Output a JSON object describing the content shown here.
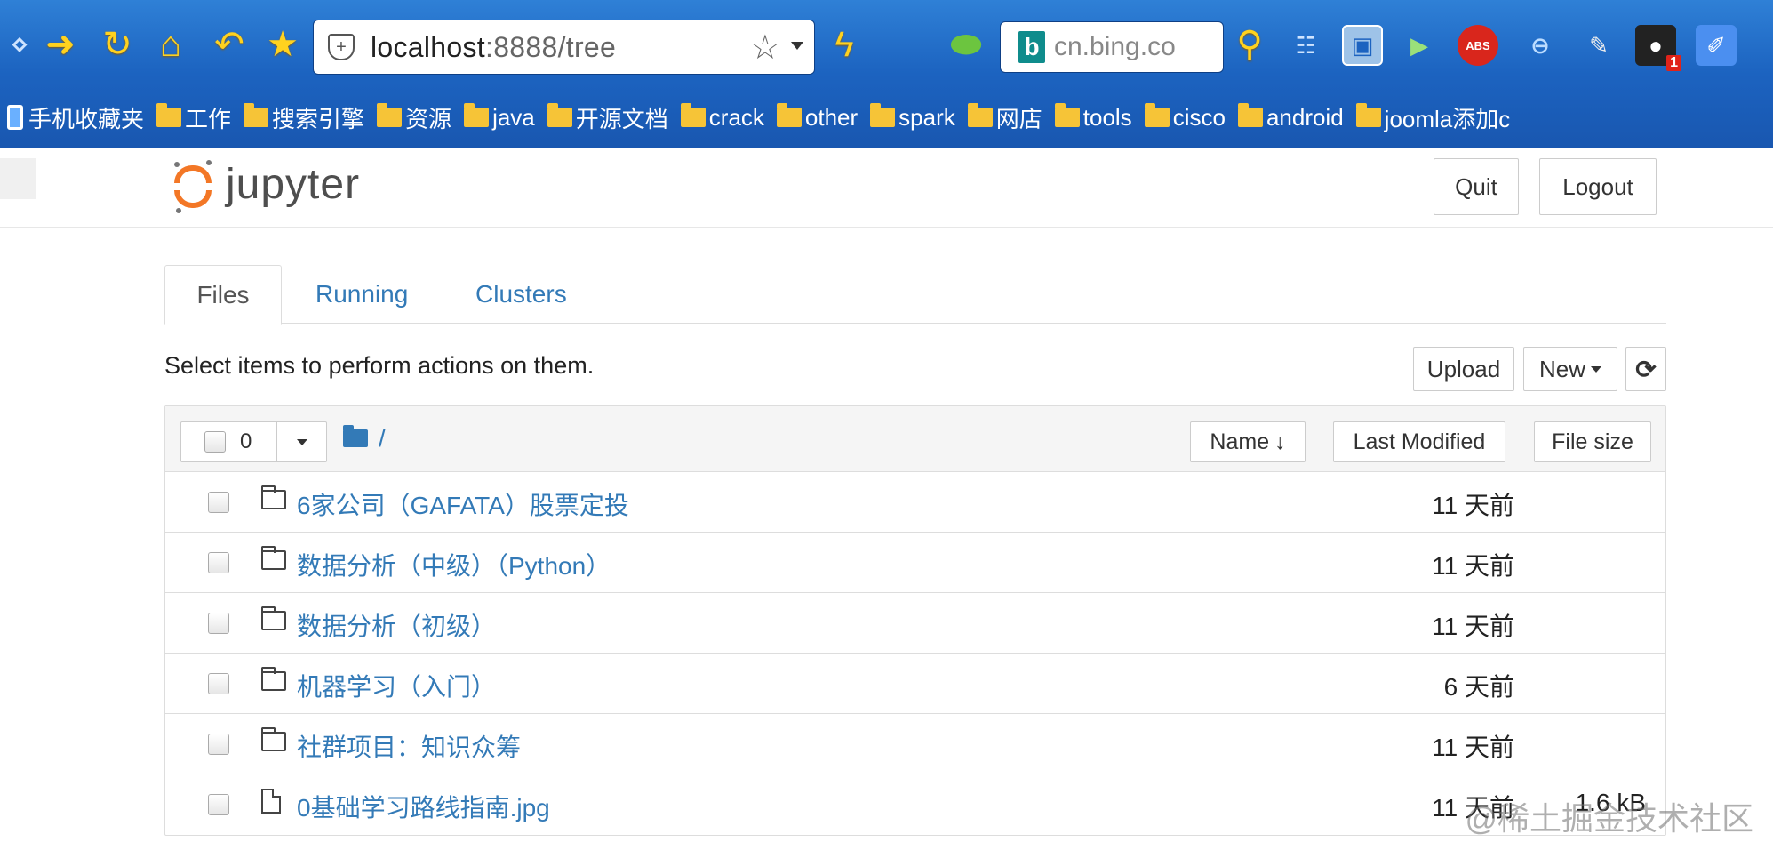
{
  "browser": {
    "url_host": "localhost",
    "url_path": ":8888/tree",
    "search_text": "cn.bing.co",
    "bing_letter": "b",
    "badge_count": "1",
    "abp_label": "ABS",
    "bookmarks": [
      {
        "label": "手机收藏夹",
        "type": "phone"
      },
      {
        "label": "工作",
        "type": "folder"
      },
      {
        "label": "搜索引擎",
        "type": "folder"
      },
      {
        "label": "资源",
        "type": "folder"
      },
      {
        "label": "java",
        "type": "folder"
      },
      {
        "label": "开源文档",
        "type": "folder"
      },
      {
        "label": "crack",
        "type": "folder"
      },
      {
        "label": "other",
        "type": "folder"
      },
      {
        "label": "spark",
        "type": "folder"
      },
      {
        "label": "网店",
        "type": "folder"
      },
      {
        "label": "tools",
        "type": "folder"
      },
      {
        "label": "cisco",
        "type": "folder"
      },
      {
        "label": "android",
        "type": "folder"
      },
      {
        "label": "joomla添加c",
        "type": "folder"
      }
    ]
  },
  "header": {
    "logo_text": "jupyter",
    "quit_label": "Quit",
    "logout_label": "Logout"
  },
  "tabs": [
    {
      "label": "Files",
      "active": true
    },
    {
      "label": "Running",
      "active": false
    },
    {
      "label": "Clusters",
      "active": false
    }
  ],
  "actions": {
    "hint": "Select items to perform actions on them.",
    "upload_label": "Upload",
    "new_label": "New"
  },
  "list_header": {
    "selected_count": "0",
    "breadcrumb": "/",
    "name_label": "Name",
    "modified_label": "Last Modified",
    "size_label": "File size"
  },
  "files": [
    {
      "name": "6家公司（GAFATA）股票定投",
      "type": "folder",
      "modified": "11 天前",
      "size": ""
    },
    {
      "name": "数据分析（中级）（Python）",
      "type": "folder",
      "modified": "11 天前",
      "size": ""
    },
    {
      "name": "数据分析（初级）",
      "type": "folder",
      "modified": "11 天前",
      "size": ""
    },
    {
      "name": "机器学习（入门）",
      "type": "folder",
      "modified": "6 天前",
      "size": ""
    },
    {
      "name": "社群项目：知识众筹",
      "type": "folder",
      "modified": "11 天前",
      "size": ""
    },
    {
      "name": "0基础学习路线指南.jpg",
      "type": "file",
      "modified": "11 天前",
      "size": "1.6 kB"
    }
  ],
  "watermark": "@稀土掘金技术社区",
  "colors": {
    "link": "#337ab7",
    "chrome": "#1c63c0",
    "logo_orange": "#f37726"
  }
}
